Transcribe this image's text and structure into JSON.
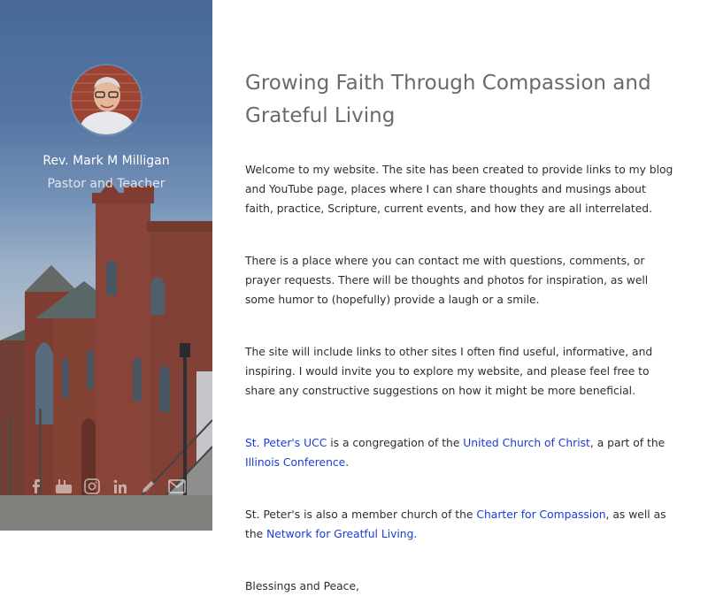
{
  "sidebar": {
    "name": "Rev. Mark M Milligan",
    "role": "Pastor and Teacher",
    "social": [
      {
        "icon": "facebook-icon",
        "glyph": "f"
      },
      {
        "icon": "youtube-icon",
        "glyph": "▶"
      },
      {
        "icon": "instagram-icon",
        "glyph": "◎"
      },
      {
        "icon": "linkedin-icon",
        "glyph": "in"
      },
      {
        "icon": "blog-icon",
        "glyph": "✎"
      },
      {
        "icon": "email-icon",
        "glyph": "✉"
      }
    ]
  },
  "main": {
    "title_line1": "Growing Faith Through Compassion and",
    "title_line2": "Grateful Living",
    "p1": "Welcome to my website. The site has been created to provide links to my blog and YouTube page, places where I can share thoughts and musings about faith, practice, Scripture, current events, and how they are all interrelated.",
    "p2": "There is a place where you can contact me with questions, comments, or prayer requests. There will be thoughts and photos for inspiration, as well some humor to (hopefully) provide a laugh or a smile.",
    "p3": "The site will include links to other sites I often find useful, informative, and inspiring. I would invite you to explore my website, and please feel free to share any constructive suggestions on how it might be more beneficial.",
    "p4": {
      "link1": "St. Peter's UCC",
      "text1": " is a congregation of the ",
      "link2": "United Church of Christ",
      "text2": ", a part of the ",
      "link3": "Illinois Conference",
      "text3": "."
    },
    "p5": {
      "text1": "St. Peter's is also a member church of the ",
      "link1": "Charter for Compassion",
      "text2": ", as well as the ",
      "link2": "Network for Greatful Living."
    },
    "p6": "Blessings and Peace,"
  },
  "colors": {
    "link": "#1a3bd6",
    "title": "#6a6a6a",
    "body_text": "#2d2d2d",
    "sidebar_sky": "#4c6f9f",
    "brick": "#8a3d2e"
  }
}
